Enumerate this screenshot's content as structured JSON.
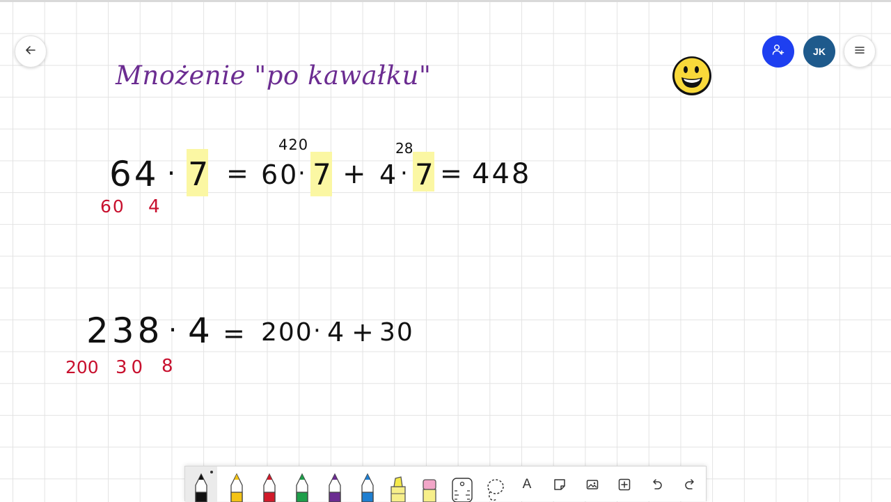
{
  "header": {
    "avatar_initials": "JK",
    "avatar_color": "#1e5a8c",
    "invite_color": "#1e3ff0"
  },
  "canvas": {
    "title": "Mnożenie \"po kawałku\"",
    "title_color": "#6b2c91",
    "ink_color": "#111111",
    "split_color": "#c8102e",
    "highlight_color": "#fbf7a3",
    "eq1": {
      "a": "64",
      "dot1": "·",
      "b": "7",
      "eq": "=",
      "p1a": "60",
      "dot2": "·",
      "p1b": "7",
      "plus": "+",
      "p2a": "4",
      "dot3": "·",
      "p2b": "7",
      "eq2": "=",
      "result": "448",
      "note1": "420",
      "note2": "28",
      "split1": "60",
      "split2": "4"
    },
    "eq2": {
      "a": "238",
      "dot1": "·",
      "b": "4",
      "eq": "=",
      "p1a": "200",
      "dot2": "·",
      "p1b": "4",
      "plus": "+",
      "p2a": "30",
      "split1": "200",
      "split2": "30",
      "split3": "8"
    }
  },
  "toolbar": {
    "tools": [
      {
        "name": "black-pen",
        "color": "#111111"
      },
      {
        "name": "yellow-pen",
        "color": "#f3c316"
      },
      {
        "name": "red-pen",
        "color": "#d11a2a"
      },
      {
        "name": "green-pen",
        "color": "#1e9e4a"
      },
      {
        "name": "purple-pen",
        "color": "#6b2c91"
      },
      {
        "name": "blue-pen",
        "color": "#1f7fd1"
      },
      {
        "name": "highlighter",
        "color": "#f5ea4a"
      },
      {
        "name": "eraser",
        "color": "#f2a6c8"
      }
    ],
    "text_tool_label": "A"
  }
}
